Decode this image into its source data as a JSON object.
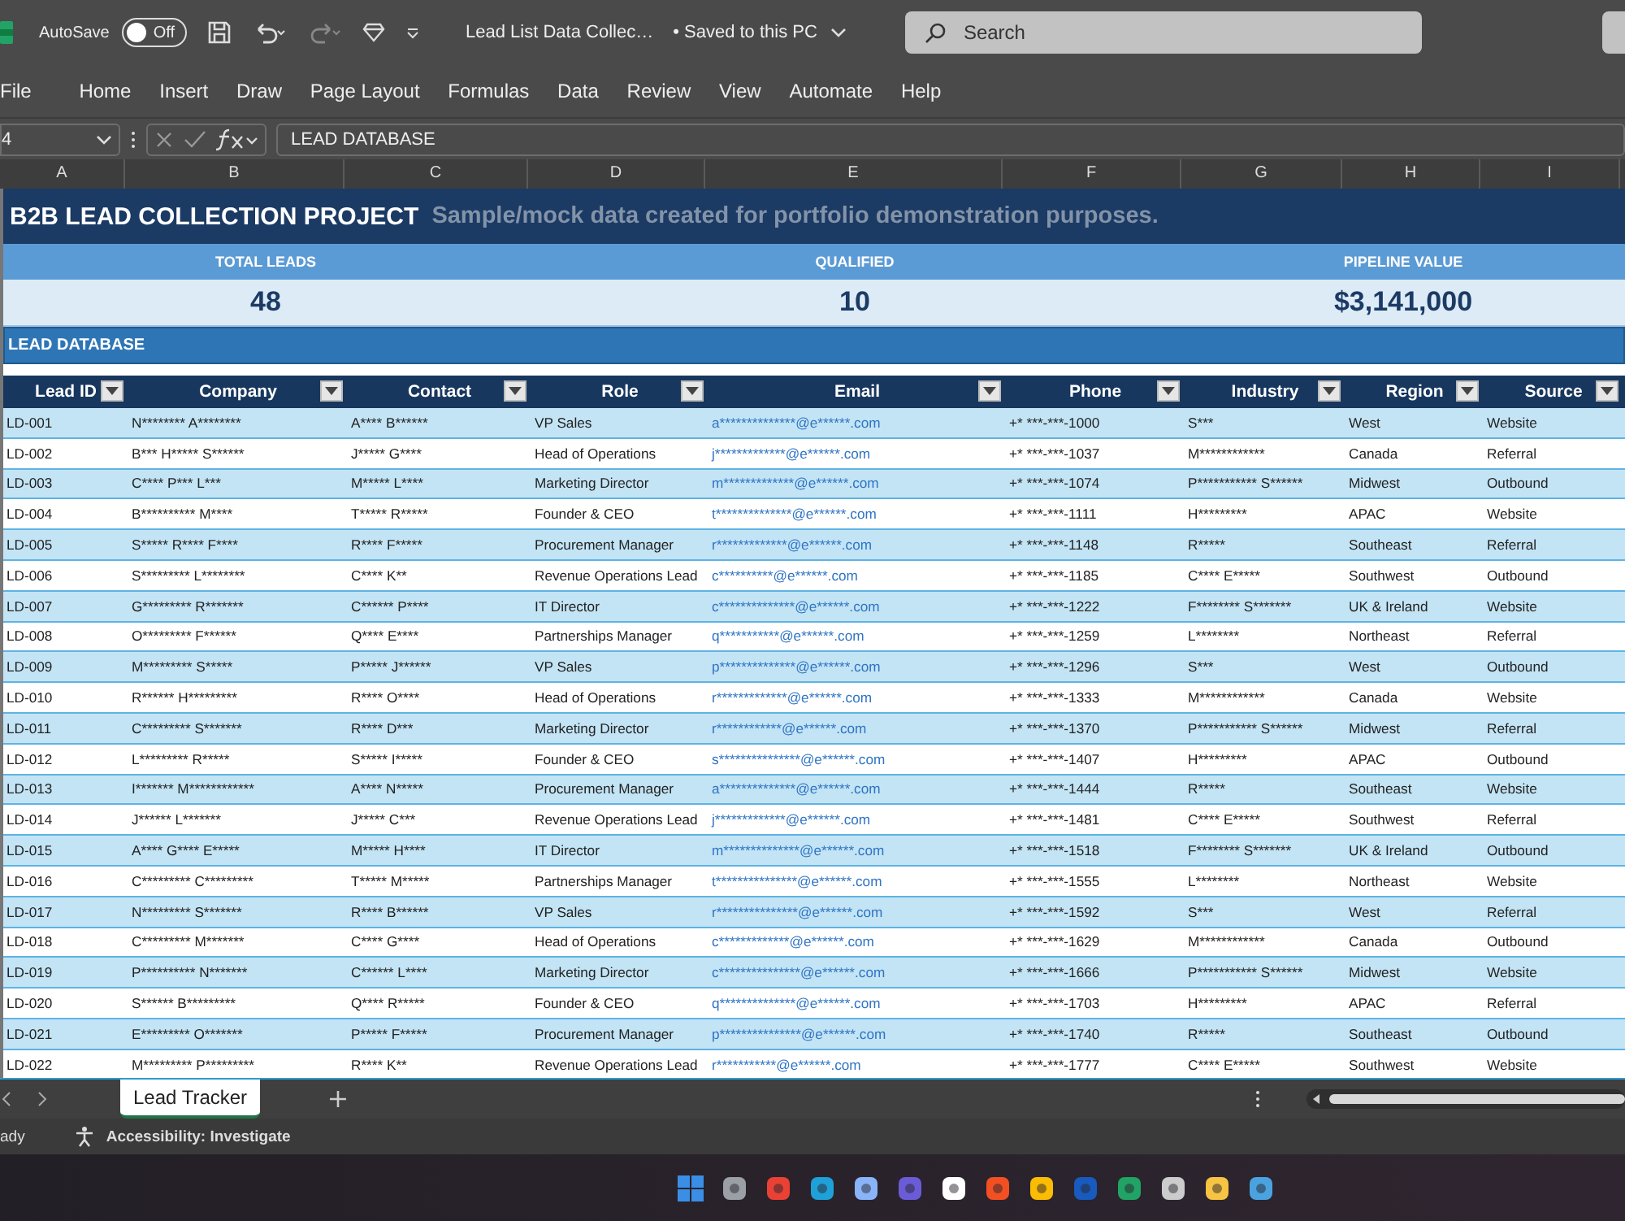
{
  "title_bar": {
    "autosave_label": "AutoSave",
    "autosave_toggle": {
      "label": "Off",
      "on": false
    },
    "document_title": "Lead List Data Collec…",
    "save_status": "• Saved to this PC",
    "search": {
      "placeholder": "Search"
    }
  },
  "ribbon_tabs": [
    "File",
    "Home",
    "Insert",
    "Draw",
    "Page Layout",
    "Formulas",
    "Data",
    "Review",
    "View",
    "Automate",
    "Help"
  ],
  "formula_bar": {
    "name_box": "4",
    "formula": "LEAD DATABASE"
  },
  "column_letters": [
    "A",
    "B",
    "C",
    "D",
    "E",
    "F",
    "G",
    "H",
    "I"
  ],
  "sheet": {
    "title": "B2B LEAD COLLECTION PROJECT",
    "subtitle": "Sample/mock data created for portfolio demonstration purposes.",
    "kpis": [
      {
        "label": "TOTAL LEADS",
        "value": "48"
      },
      {
        "label": "QUALIFIED",
        "value": "10"
      },
      {
        "label": "PIPELINE VALUE",
        "value": "$3,141,000"
      }
    ],
    "section_title": "LEAD DATABASE",
    "table": {
      "columns": [
        {
          "label": "Lead ID",
          "kind": "text"
        },
        {
          "label": "Company",
          "kind": "text"
        },
        {
          "label": "Contact",
          "kind": "text"
        },
        {
          "label": "Role",
          "kind": "text"
        },
        {
          "label": "Email",
          "kind": "link"
        },
        {
          "label": "Phone",
          "kind": "text"
        },
        {
          "label": "Industry",
          "kind": "text"
        },
        {
          "label": "Region",
          "kind": "text"
        },
        {
          "label": "Source",
          "kind": "text"
        }
      ],
      "rows": [
        [
          "LD-001",
          "N******** A********",
          "A**** B******",
          "VP Sales",
          "a**************@e******.com",
          "+* ***-***-1000",
          "S***",
          "West",
          "Website"
        ],
        [
          "LD-002",
          "B*** H***** S******",
          "J***** G****",
          "Head of Operations",
          "j*************@e******.com",
          "+* ***-***-1037",
          "M************",
          "Canada",
          "Referral"
        ],
        [
          "LD-003",
          "C**** P*** L***",
          "M***** L****",
          "Marketing Director",
          "m*************@e******.com",
          "+* ***-***-1074",
          "P*********** S******",
          "Midwest",
          "Outbound"
        ],
        [
          "LD-004",
          "B********** M****",
          "T***** R*****",
          "Founder & CEO",
          "t**************@e******.com",
          "+* ***-***-1111",
          "H*********",
          "APAC",
          "Website"
        ],
        [
          "LD-005",
          "S***** R**** F****",
          "R**** F*****",
          "Procurement Manager",
          "r*************@e******.com",
          "+* ***-***-1148",
          "R*****",
          "Southeast",
          "Referral"
        ],
        [
          "LD-006",
          "S********* L********",
          "C**** K**",
          "Revenue Operations Lead",
          "c**********@e******.com",
          "+* ***-***-1185",
          "C**** E*****",
          "Southwest",
          "Outbound"
        ],
        [
          "LD-007",
          "G********* R*******",
          "C****** P****",
          "IT Director",
          "c**************@e******.com",
          "+* ***-***-1222",
          "F******** S*******",
          "UK & Ireland",
          "Website"
        ],
        [
          "LD-008",
          "O********* F******",
          "Q**** E****",
          "Partnerships Manager",
          "q***********@e******.com",
          "+* ***-***-1259",
          "L********",
          "Northeast",
          "Referral"
        ],
        [
          "LD-009",
          "M********* S*****",
          "P***** J******",
          "VP Sales",
          "p**************@e******.com",
          "+* ***-***-1296",
          "S***",
          "West",
          "Outbound"
        ],
        [
          "LD-010",
          "R****** H*********",
          "R**** O****",
          "Head of Operations",
          "r*************@e******.com",
          "+* ***-***-1333",
          "M************",
          "Canada",
          "Website"
        ],
        [
          "LD-011",
          "C********* S*******",
          "R**** D***",
          "Marketing Director",
          "r************@e******.com",
          "+* ***-***-1370",
          "P*********** S******",
          "Midwest",
          "Referral"
        ],
        [
          "LD-012",
          "L********* R*****",
          "S***** I*****",
          "Founder & CEO",
          "s***************@e******.com",
          "+* ***-***-1407",
          "H*********",
          "APAC",
          "Outbound"
        ],
        [
          "LD-013",
          "I******* M************",
          "A**** N*****",
          "Procurement Manager",
          "a**************@e******.com",
          "+* ***-***-1444",
          "R*****",
          "Southeast",
          "Website"
        ],
        [
          "LD-014",
          "J****** L*******",
          "J***** C***",
          "Revenue Operations Lead",
          "j*************@e******.com",
          "+* ***-***-1481",
          "C**** E*****",
          "Southwest",
          "Referral"
        ],
        [
          "LD-015",
          "A**** G**** E*****",
          "M***** H****",
          "IT Director",
          "m**************@e******.com",
          "+* ***-***-1518",
          "F******** S*******",
          "UK & Ireland",
          "Outbound"
        ],
        [
          "LD-016",
          "C********* C*********",
          "T***** M*****",
          "Partnerships Manager",
          "t***************@e******.com",
          "+* ***-***-1555",
          "L********",
          "Northeast",
          "Website"
        ],
        [
          "LD-017",
          "N********* S*******",
          "R**** B******",
          "VP Sales",
          "r***************@e******.com",
          "+* ***-***-1592",
          "S***",
          "West",
          "Referral"
        ],
        [
          "LD-018",
          "C********* M*******",
          "C**** G****",
          "Head of Operations",
          "c*************@e******.com",
          "+* ***-***-1629",
          "M************",
          "Canada",
          "Outbound"
        ],
        [
          "LD-019",
          "P********** N*******",
          "C****** L****",
          "Marketing Director",
          "c***************@e******.com",
          "+* ***-***-1666",
          "P*********** S******",
          "Midwest",
          "Website"
        ],
        [
          "LD-020",
          "S****** B*********",
          "Q**** R*****",
          "Founder & CEO",
          "q**************@e******.com",
          "+* ***-***-1703",
          "H*********",
          "APAC",
          "Referral"
        ],
        [
          "LD-021",
          "E********* O*******",
          "P***** F*****",
          "Procurement Manager",
          "p***************@e******.com",
          "+* ***-***-1740",
          "R*****",
          "Southeast",
          "Outbound"
        ],
        [
          "LD-022",
          "M********* P*********",
          "R**** K**",
          "Revenue Operations Lead",
          "r***********@e******.com",
          "+* ***-***-1777",
          "C**** E*****",
          "Southwest",
          "Website"
        ]
      ]
    }
  },
  "sheet_tabs": [
    {
      "label": "Lead Tracker",
      "selected": true
    }
  ],
  "status_bar": {
    "status": "ady",
    "accessibility": "Accessibility: Investigate"
  }
}
